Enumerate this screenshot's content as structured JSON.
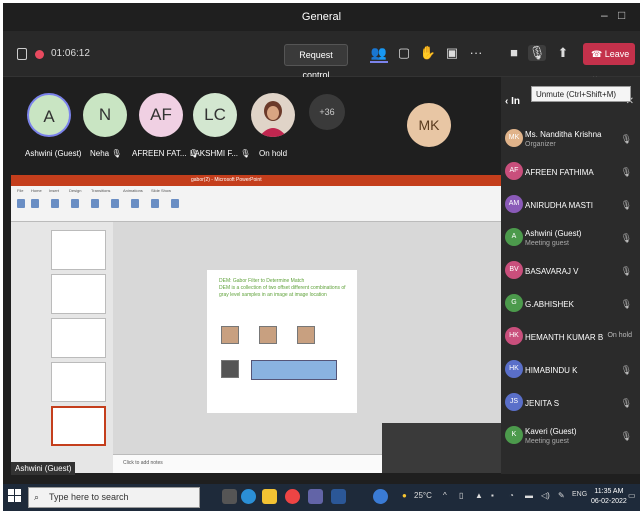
{
  "window": {
    "title": "General"
  },
  "toolbar": {
    "timer": "01:06:12",
    "request_control": "Request control",
    "leave": "Leave"
  },
  "tooltip": "Unmute (Ctrl+Shift+M)",
  "strip": {
    "participants": [
      {
        "initials": "A",
        "label": "Ashwini (Guest)",
        "color": "#c9e5c3"
      },
      {
        "initials": "N",
        "label": "Neha",
        "color": "#c9e5c3"
      },
      {
        "initials": "AF",
        "label": "AFREEN FAT...",
        "color": "#f0d0e3"
      },
      {
        "initials": "LC",
        "label": "LAKSHMI F...",
        "color": "#d3e7d0"
      },
      {
        "initials": "",
        "label": "On hold",
        "color": "#cf3a6a"
      }
    ],
    "more": "+36",
    "extra_initials": "MK"
  },
  "presenter": "Ashwini (Guest)",
  "shared_screen": {
    "ppt_window_title": "gabor(2) - Microsoft PowerPoint",
    "slide_bullet": "DEM: Gabor Filter to Determine Match",
    "slide_text": "DEM is a collection of two offset different combinations of gray level samples in an image at image location",
    "notes_placeholder": "Click to add notes"
  },
  "panel": {
    "title": "In",
    "rows": [
      {
        "initials": "MK",
        "name": "Ms. Nanditha Krishna",
        "sub": "Organizer",
        "color": "#e0b38a",
        "status": ""
      },
      {
        "initials": "AF",
        "name": "AFREEN FATHIMA",
        "sub": "",
        "color": "#c94f7c",
        "status": ""
      },
      {
        "initials": "AM",
        "name": "ANIRUDHA MASTI",
        "sub": "",
        "color": "#8a5ab8",
        "status": ""
      },
      {
        "initials": "A",
        "name": "Ashwini (Guest)",
        "sub": "Meeting guest",
        "color": "#4c9a4c",
        "status": ""
      },
      {
        "initials": "BV",
        "name": "BASAVARAJ V",
        "sub": "",
        "color": "#c94f7c",
        "status": ""
      },
      {
        "initials": "G",
        "name": "G.ABHISHEK",
        "sub": "",
        "color": "#4c9a4c",
        "status": ""
      },
      {
        "initials": "HK",
        "name": "HEMANTH KUMAR B",
        "sub": "",
        "color": "#c94f7c",
        "status": "On hold"
      },
      {
        "initials": "HK",
        "name": "HIMABINDU K",
        "sub": "",
        "color": "#5a6fc9",
        "status": ""
      },
      {
        "initials": "JS",
        "name": "JENITA S",
        "sub": "",
        "color": "#5a6fc9",
        "status": ""
      },
      {
        "initials": "K",
        "name": "Kaveri (Guest)",
        "sub": "Meeting guest",
        "color": "#4c9a4c",
        "status": ""
      }
    ]
  },
  "taskbar": {
    "search_placeholder": "Type here to search",
    "temperature": "25°C",
    "language": "ENG",
    "time": "11:35 AM",
    "date": "06-02-2022"
  }
}
